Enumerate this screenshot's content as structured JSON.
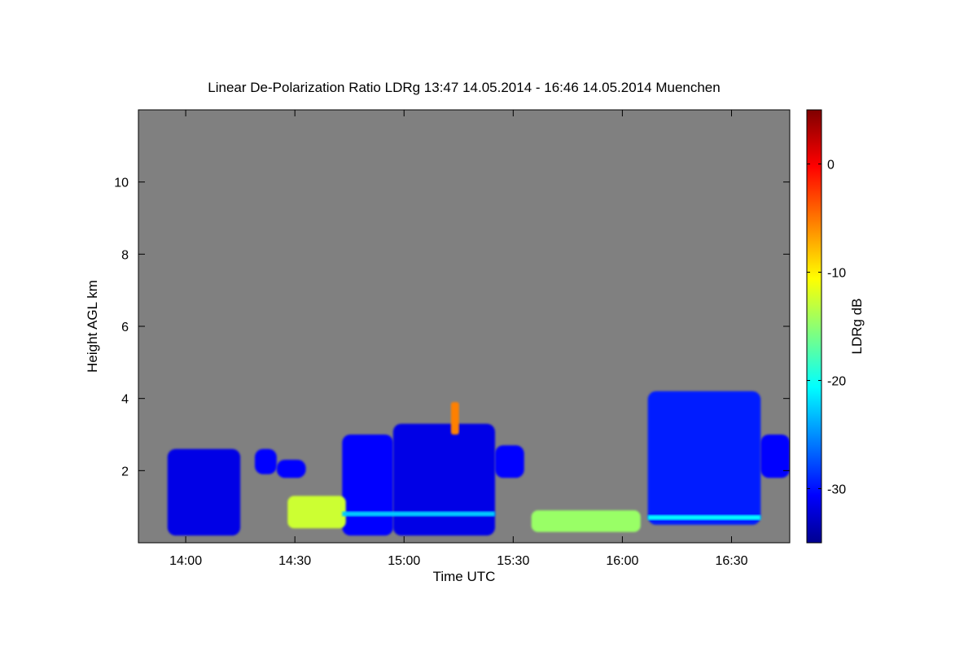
{
  "chart_data": {
    "type": "heatmap",
    "title": "Linear De-Polarization Ratio LDRg   13:47 14.05.2014 - 16:46 14.05.2014 Muenchen",
    "xlabel": "Time UTC",
    "ylabel": "Height AGL km",
    "colorbar_label": "LDRg dB",
    "x_range_utc": [
      "13:47",
      "16:46"
    ],
    "x_ticks": [
      "14:00",
      "14:30",
      "15:00",
      "15:30",
      "16:00",
      "16:30"
    ],
    "y_range_km": [
      0,
      12
    ],
    "y_ticks": [
      2,
      4,
      6,
      8,
      10
    ],
    "colorbar_range_db": [
      -35,
      5
    ],
    "colorbar_ticks": [
      0,
      -10,
      -20,
      -30
    ],
    "colormap": "jet",
    "background_color": "#808080",
    "regions": [
      {
        "t0": "13:55",
        "t1": "14:15",
        "h0": 0.2,
        "h1": 2.6,
        "ldr_db": -31
      },
      {
        "t0": "14:19",
        "t1": "14:25",
        "h0": 1.9,
        "h1": 2.6,
        "ldr_db": -30
      },
      {
        "t0": "14:25",
        "t1": "14:33",
        "h0": 1.8,
        "h1": 2.3,
        "ldr_db": -30
      },
      {
        "t0": "14:43",
        "t1": "14:57",
        "h0": 0.2,
        "h1": 3.0,
        "ldr_db": -30
      },
      {
        "t0": "14:57",
        "t1": "15:25",
        "h0": 0.2,
        "h1": 3.3,
        "ldr_db": -31
      },
      {
        "t0": "15:25",
        "t1": "15:33",
        "h0": 1.8,
        "h1": 2.7,
        "ldr_db": -30
      },
      {
        "t0": "16:07",
        "t1": "16:38",
        "h0": 0.5,
        "h1": 4.2,
        "ldr_db": -29
      },
      {
        "t0": "16:38",
        "t1": "16:46",
        "h0": 1.8,
        "h1": 3.0,
        "ldr_db": -30
      }
    ],
    "melting_layer": [
      {
        "t0": "14:43",
        "t1": "15:25",
        "h_km": 0.8,
        "ldr_db": -22
      },
      {
        "t0": "16:07",
        "t1": "16:38",
        "h_km": 0.7,
        "ldr_db": -20
      }
    ],
    "boundary_layer": [
      {
        "t0": "14:28",
        "t1": "14:44",
        "h0": 0.4,
        "h1": 1.3,
        "ldr_db": -12
      },
      {
        "t0": "15:35",
        "t1": "16:05",
        "h0": 0.3,
        "h1": 0.9,
        "ldr_db": -14
      }
    ],
    "hotspot": {
      "t": "15:14",
      "h0": 3.0,
      "h1": 3.9,
      "ldr_db": -5
    }
  }
}
